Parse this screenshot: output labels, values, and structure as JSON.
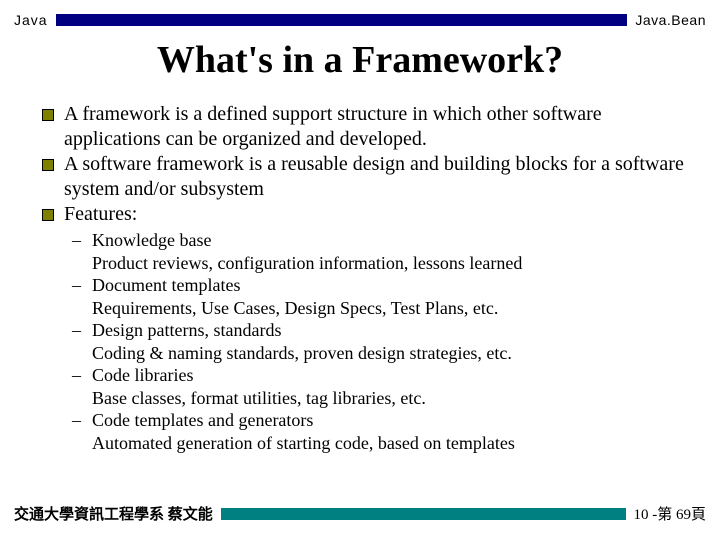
{
  "header": {
    "left": "Java",
    "right": "Java.Bean"
  },
  "title": "What's in a Framework?",
  "bullets": [
    "A framework is a defined support structure in which other software applications can be organized and developed.",
    "A software framework is a reusable design and building blocks for a software system and/or subsystem",
    "Features:"
  ],
  "features": [
    {
      "name": "Knowledge base",
      "desc": "Product reviews, configuration information, lessons learned"
    },
    {
      "name": "Document templates",
      "desc": "Requirements, Use Cases, Design Specs, Test Plans, etc."
    },
    {
      "name": "Design patterns, standards",
      "desc": "Coding & naming standards, proven design strategies, etc."
    },
    {
      "name": "Code libraries",
      "desc": "Base classes, format utilities, tag libraries, etc."
    },
    {
      "name": "Code templates and generators",
      "desc": "Automated generation of starting code, based on templates"
    }
  ],
  "footer": {
    "left": "交通大學資訊工程學系 蔡文能",
    "right": "10 -第 69頁"
  }
}
